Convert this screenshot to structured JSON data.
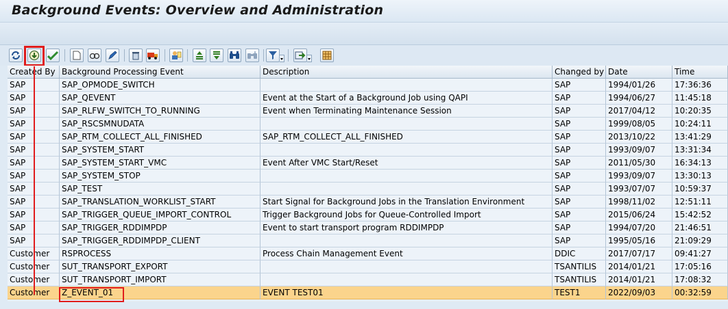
{
  "title": "Background Events: Overview and Administration",
  "toolbar": {
    "buttons": [
      {
        "name": "refresh-icon"
      },
      {
        "name": "execute-event-icon",
        "highlighted": true
      },
      {
        "name": "check-icon"
      },
      {
        "name": "create-icon"
      },
      {
        "name": "display-icon"
      },
      {
        "name": "change-icon"
      },
      {
        "name": "delete-icon"
      },
      {
        "name": "transport-icon"
      },
      {
        "name": "where-used-icon"
      },
      {
        "name": "sort-ascending-icon"
      },
      {
        "name": "sort-descending-icon"
      },
      {
        "name": "find-icon"
      },
      {
        "name": "find-next-icon"
      },
      {
        "name": "filter-icon"
      },
      {
        "name": "export-icon"
      },
      {
        "name": "layout-icon"
      }
    ]
  },
  "table": {
    "columns": [
      "Created By",
      "Background Processing Event",
      "Description",
      "Changed by",
      "Date",
      "Time"
    ],
    "rows": [
      [
        "SAP",
        "SAP_OPMODE_SWITCH",
        "",
        "SAP",
        "1994/01/26",
        "17:36:36"
      ],
      [
        "SAP",
        "SAP_QEVENT",
        "Event at the Start of a Background Job using QAPI",
        "SAP",
        "1994/06/27",
        "11:45:18"
      ],
      [
        "SAP",
        "SAP_RLFW_SWITCH_TO_RUNNING",
        "Event when Terminating Maintenance Session",
        "SAP",
        "2017/04/12",
        "10:20:35"
      ],
      [
        "SAP",
        "SAP_RSCSMNUDATA",
        "",
        "SAP",
        "1999/08/05",
        "10:24:11"
      ],
      [
        "SAP",
        "SAP_RTM_COLLECT_ALL_FINISHED",
        "SAP_RTM_COLLECT_ALL_FINISHED",
        "SAP",
        "2013/10/22",
        "13:41:29"
      ],
      [
        "SAP",
        "SAP_SYSTEM_START",
        "",
        "SAP",
        "1993/09/07",
        "13:31:34"
      ],
      [
        "SAP",
        "SAP_SYSTEM_START_VMC",
        "Event After VMC Start/Reset",
        "SAP",
        "2011/05/30",
        "16:34:13"
      ],
      [
        "SAP",
        "SAP_SYSTEM_STOP",
        "",
        "SAP",
        "1993/09/07",
        "13:30:13"
      ],
      [
        "SAP",
        "SAP_TEST",
        "",
        "SAP",
        "1993/07/07",
        "10:59:37"
      ],
      [
        "SAP",
        "SAP_TRANSLATION_WORKLIST_START",
        "Start Signal for Background Jobs in the Translation Environment",
        "SAP",
        "1998/11/02",
        "12:51:11"
      ],
      [
        "SAP",
        "SAP_TRIGGER_QUEUE_IMPORT_CONTROL",
        "Trigger Background Jobs for Queue-Controlled Import",
        "SAP",
        "2015/06/24",
        "15:42:52"
      ],
      [
        "SAP",
        "SAP_TRIGGER_RDDIMPDP",
        "Event to start transport program RDDIMPDP",
        "SAP",
        "1994/07/20",
        "21:46:51"
      ],
      [
        "SAP",
        "SAP_TRIGGER_RDDIMPDP_CLIENT",
        "",
        "SAP",
        "1995/05/16",
        "21:09:29"
      ],
      [
        "Customer",
        "RSPROCESS",
        "Process Chain Management Event",
        "DDIC",
        "2017/07/17",
        "09:41:27"
      ],
      [
        "Customer",
        "SUT_TRANSPORT_EXPORT",
        "",
        "TSANTILIS",
        "2014/01/21",
        "17:05:16"
      ],
      [
        "Customer",
        "SUT_TRANSPORT_IMPORT",
        "",
        "TSANTILIS",
        "2014/01/21",
        "17:08:32"
      ],
      [
        "Customer",
        "Z_EVENT_01",
        "EVENT TEST01",
        "TEST1",
        "2022/09/03",
        "00:32:59"
      ]
    ],
    "selected_row": 16
  },
  "colors": {
    "selected_row": "#fbd48c",
    "annotation": "#e01c1c"
  }
}
